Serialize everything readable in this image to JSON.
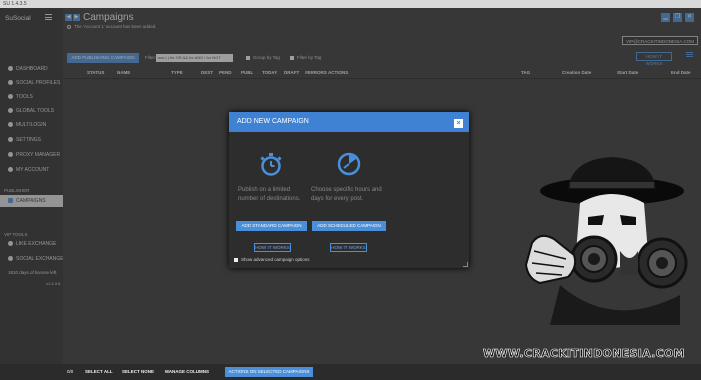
{
  "window": {
    "title": "SU 1.4.3.5"
  },
  "sidebar": {
    "brand": "SuSocial",
    "items": [
      {
        "label": "DASHBOARD"
      },
      {
        "label": "SOCIAL PROFILES"
      },
      {
        "label": "TOOLS"
      },
      {
        "label": "GLOBAL TOOLS"
      },
      {
        "label": "MULTILOGIN"
      },
      {
        "label": "SETTINGS"
      },
      {
        "label": "PROXY MANAGER"
      },
      {
        "label": "MY ACCOUNT"
      }
    ],
    "publisher_section": "PUBLISHER",
    "publisher_item": "CAMPAIGNS",
    "vip_section": "VIP TOOLS",
    "vip_items": [
      {
        "label": "LIKE EXCHANGE"
      },
      {
        "label": "SOCIAL EXCHANGE"
      }
    ],
    "license": "1810 days of license left.",
    "version": "v1.4.3.5"
  },
  "header": {
    "title": "Campaigns",
    "notice": "The 'Account 1' account has been added.",
    "account": "VIP@CRACKITINDONESIA.COM",
    "how_it_works": "HOW IT WORKS"
  },
  "toolbar": {
    "add_publishing": "ADD PUBLISHING CAMPAIGN",
    "filter_label": "Filter:",
    "filter_value": "use | | for OR && for AND ! for NOT",
    "group_by_tag": "Group by Tag",
    "filter_by_tag": "Filter by Tag"
  },
  "table": {
    "columns": [
      "STATUS",
      "NAME",
      "TYPE",
      "DEST",
      "PEND",
      "PUBL",
      "TODAY",
      "DRAFT",
      "#ERRORS",
      "ACTIONS",
      "TAG",
      "Creation Date",
      "Start Date",
      "End Date"
    ]
  },
  "modal": {
    "title": "ADD NEW CAMPAIGN",
    "close": "×",
    "standard_desc_1": "Publish on a limited",
    "standard_desc_2": "number of destinations.",
    "scheduled_desc_1": "Choose specific hours and",
    "scheduled_desc_2": "days for every post.",
    "add_standard": "ADD STANDARD CAMPAIGN",
    "add_scheduled": "ADD SCHEDULED CAMPAIGN",
    "how_it_works": "HOW IT WORKS",
    "advanced": "Show advanced campaign options"
  },
  "footer": {
    "count": "0/0",
    "select_all": "SELECT ALL",
    "select_none": "SELECT NONE",
    "manage_columns": "MANAGE COLUMNS",
    "actions": "ACTIONS ON SELECTED CAMPAIGNS"
  },
  "watermark": {
    "text": "WWW.CRACKITINDONESIA.COM"
  },
  "colors": {
    "accent": "#4a8fd9",
    "modal_header": "#3f82d3",
    "background": "#3a3a3a"
  }
}
